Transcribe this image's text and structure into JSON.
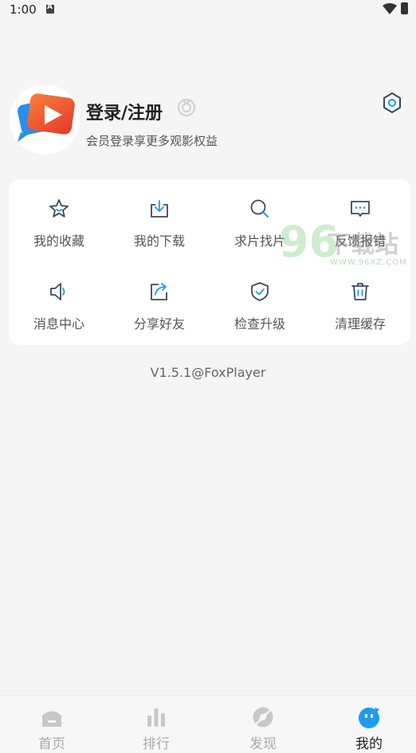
{
  "status_bar": {
    "time": "1:00"
  },
  "profile": {
    "title": "登录/注册",
    "subtitle": "会员登录享更多观影权益"
  },
  "menu": {
    "items": [
      {
        "label": "我的收藏",
        "icon": "star-icon"
      },
      {
        "label": "我的下载",
        "icon": "download-icon"
      },
      {
        "label": "求片找片",
        "icon": "search-icon"
      },
      {
        "label": "反馈报错",
        "icon": "feedback-icon"
      },
      {
        "label": "消息中心",
        "icon": "speaker-icon"
      },
      {
        "label": "分享好友",
        "icon": "share-icon"
      },
      {
        "label": "检查升级",
        "icon": "shield-check-icon"
      },
      {
        "label": "清理缓存",
        "icon": "trash-icon"
      }
    ]
  },
  "watermark": {
    "number": "96",
    "text": "下载站",
    "url": "WWW.96XZ.COM"
  },
  "version": "V1.5.1@FoxPlayer",
  "tabbar": {
    "tabs": [
      {
        "label": "首页",
        "icon": "home-icon"
      },
      {
        "label": "排行",
        "icon": "rank-icon"
      },
      {
        "label": "发现",
        "icon": "discover-icon"
      },
      {
        "label": "我的",
        "icon": "profile-icon"
      }
    ],
    "active_index": 3
  },
  "colors": {
    "accent": "#1e9bf0",
    "icon_dark": "#3a4a5a",
    "background": "#f5f5f5"
  }
}
